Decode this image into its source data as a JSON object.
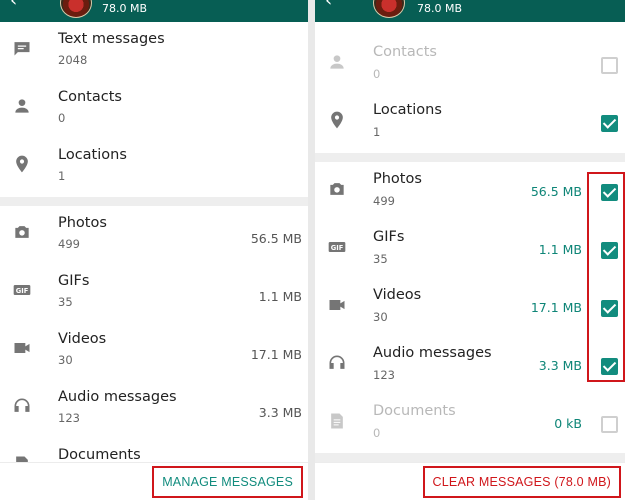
{
  "left": {
    "header": {
      "storage_size": "78.0 MB"
    },
    "message_rows": [
      {
        "title": "Text messages",
        "count": "2048",
        "icon": "message-icon"
      },
      {
        "title": "Contacts",
        "count": "0",
        "icon": "person-icon"
      },
      {
        "title": "Locations",
        "count": "1",
        "icon": "location-pin-icon"
      }
    ],
    "media_rows": [
      {
        "title": "Photos",
        "count": "499",
        "size": "56.5 MB",
        "icon": "camera-icon"
      },
      {
        "title": "GIFs",
        "count": "35",
        "size": "1.1 MB",
        "icon": "gif-icon"
      },
      {
        "title": "Videos",
        "count": "30",
        "size": "17.1 MB",
        "icon": "video-icon"
      },
      {
        "title": "Audio messages",
        "count": "123",
        "size": "3.3 MB",
        "icon": "headphones-icon"
      },
      {
        "title": "Documents",
        "count": "",
        "size": "",
        "icon": "document-icon"
      }
    ],
    "action_label": "MANAGE MESSAGES"
  },
  "right": {
    "header": {
      "storage_size": "78.0 MB"
    },
    "message_rows": [
      {
        "title": "Contacts",
        "count": "0",
        "icon": "person-icon",
        "checked": false,
        "disabled": true
      },
      {
        "title": "Locations",
        "count": "1",
        "icon": "location-pin-icon",
        "checked": true,
        "disabled": false
      }
    ],
    "media_rows": [
      {
        "title": "Photos",
        "count": "499",
        "size": "56.5 MB",
        "icon": "camera-icon",
        "checked": true
      },
      {
        "title": "GIFs",
        "count": "35",
        "size": "1.1 MB",
        "icon": "gif-icon",
        "checked": true
      },
      {
        "title": "Videos",
        "count": "30",
        "size": "17.1 MB",
        "icon": "video-icon",
        "checked": true
      },
      {
        "title": "Audio messages",
        "count": "123",
        "size": "3.3 MB",
        "icon": "headphones-icon",
        "checked": true
      },
      {
        "title": "Documents",
        "count": "0",
        "size": "0 kB",
        "icon": "document-icon",
        "checked": false,
        "disabled": true
      }
    ],
    "action_label": "CLEAR MESSAGES (78.0 MB)"
  },
  "colors": {
    "app_bar": "#075e54",
    "accent": "#128c7e",
    "highlight": "#d0161b"
  }
}
